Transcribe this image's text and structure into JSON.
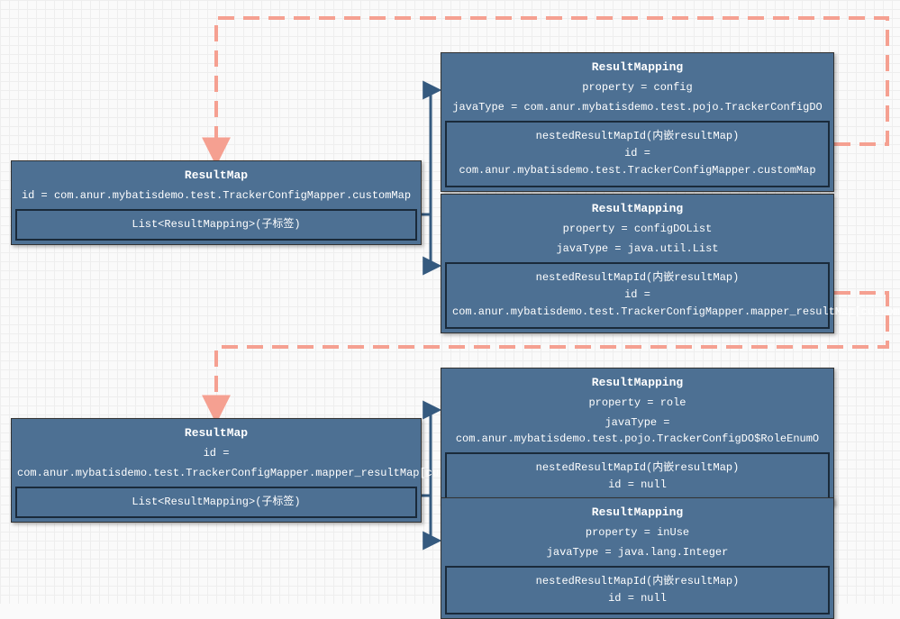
{
  "resultMap1": {
    "title": "ResultMap",
    "id": "id = com.anur.mybatisdemo.test.TrackerConfigMapper.customMap",
    "sub": "List<ResultMapping>(子标签)"
  },
  "mapping1": {
    "title": "ResultMapping",
    "prop": "property = config",
    "java": "javaType = com.anur.mybatisdemo.test.pojo.TrackerConfigDO",
    "nest1": "nestedResultMapId(内嵌resultMap)",
    "nest2": "id = com.anur.mybatisdemo.test.TrackerConfigMapper.customMap"
  },
  "mapping2": {
    "title": "ResultMapping",
    "prop": "property = configDOList",
    "java": "javaType = java.util.List",
    "nest1": "nestedResultMapId(内嵌resultMap)",
    "nest2": "id =",
    "nest3": "com.anur.mybatisdemo.test.TrackerConfigMapper.mapper_resultMap[customMap]_collection[configDOList]"
  },
  "resultMap2": {
    "title": "ResultMap",
    "id1": "id =",
    "id2": "com.anur.mybatisdemo.test.TrackerConfigMapper.mapper_resultMap[customMap]_collection[configDOList]",
    "sub": "List<ResultMapping>(子标签)"
  },
  "mapping3": {
    "title": "ResultMapping",
    "prop": "property = role",
    "java": "javaType = com.anur.mybatisdemo.test.pojo.TrackerConfigDO$RoleEnumO",
    "nest1": "nestedResultMapId(内嵌resultMap)",
    "nest2": "id = null"
  },
  "mapping4": {
    "title": "ResultMapping",
    "prop": "property = inUse",
    "java": "javaType = java.lang.Integer",
    "nest1": "nestedResultMapId(内嵌resultMap)",
    "nest2": "id = null"
  }
}
